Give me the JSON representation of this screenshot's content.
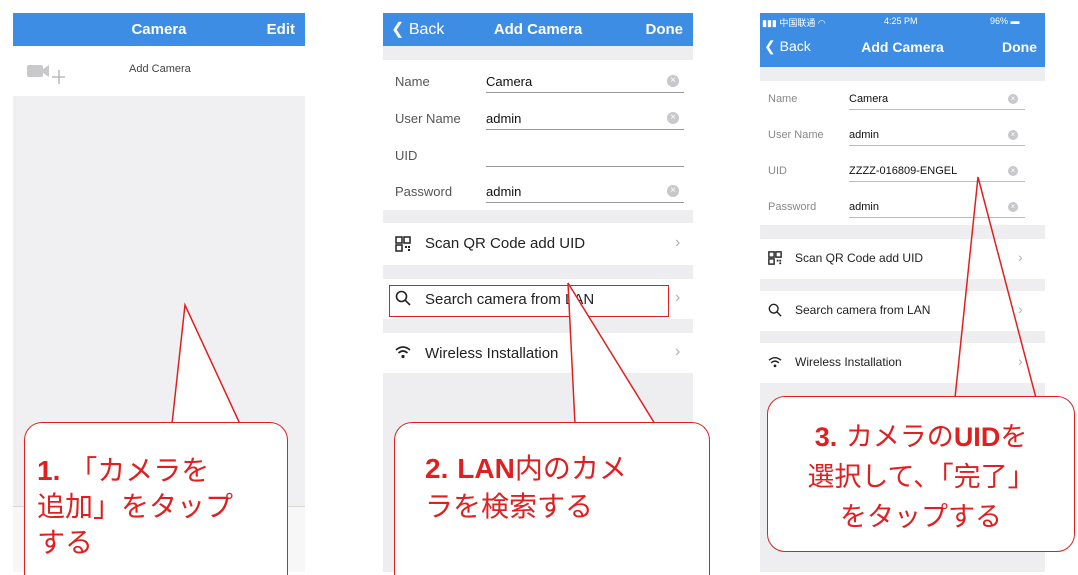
{
  "panel1": {
    "nav": {
      "title": "Camera",
      "right": "Edit"
    },
    "add_camera_label": "Add Camera"
  },
  "panel2": {
    "nav": {
      "back": "Back",
      "title": "Add Camera",
      "done": "Done"
    },
    "fields": [
      {
        "label": "Name",
        "value": "Camera"
      },
      {
        "label": "User Name",
        "value": "admin"
      },
      {
        "label": "UID",
        "value": ""
      },
      {
        "label": "Password",
        "value": "admin"
      }
    ],
    "scan_qr": "Scan QR Code add UID",
    "search_lan": "Search camera from LAN",
    "wireless": "Wireless Installation"
  },
  "panel3": {
    "status": {
      "carrier": "中国联通",
      "time": "4:25 PM",
      "battery": "96%"
    },
    "nav": {
      "back": "Back",
      "title": "Add Camera",
      "done": "Done"
    },
    "fields": [
      {
        "label": "Name",
        "value": "Camera"
      },
      {
        "label": "User Name",
        "value": "admin"
      },
      {
        "label": "UID",
        "value": "ZZZZ-016809-ENGEL"
      },
      {
        "label": "Password",
        "value": "admin"
      }
    ],
    "scan_qr": "Scan QR Code add UID",
    "search_lan": "Search camera from LAN",
    "wireless": "Wireless Installation"
  },
  "callouts": [
    {
      "num": "1.",
      "line1": "「カメラを",
      "line2": "追加」をタップ",
      "line3": "する"
    },
    {
      "num": "2.",
      "line1_bold": "LAN",
      "line1_rest": "内のカメ",
      "line2": "ラを検索する"
    },
    {
      "num": "3.",
      "line1_a": "カメラの",
      "line1_bold": "UID",
      "line1_b": "を",
      "line2": "選択して、「完了」",
      "line3": "をタップする"
    }
  ],
  "colors": {
    "nav": "#3e8de4",
    "callout": "#e02020"
  }
}
